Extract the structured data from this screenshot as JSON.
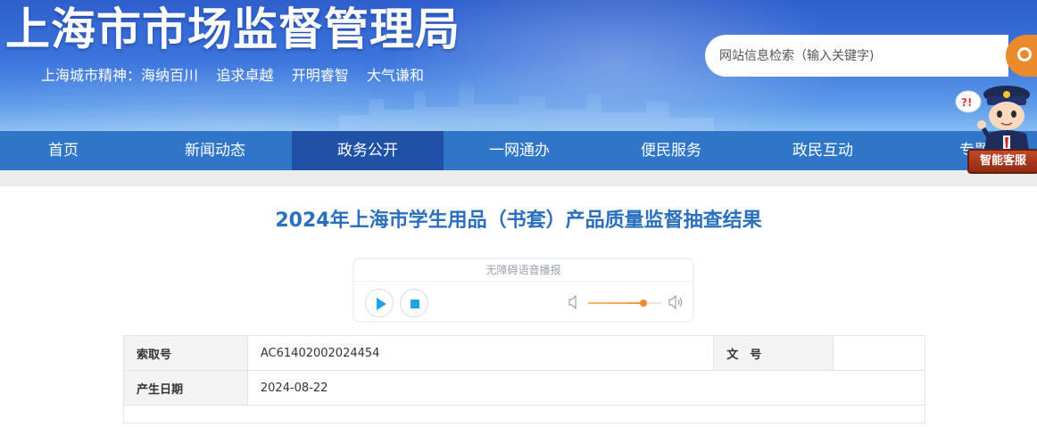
{
  "header": {
    "title": "上海市市场监督管理局",
    "motto": "上海城市精神：海纳百川    追求卓越    开明睿智    大气谦和"
  },
  "search": {
    "placeholder": "网站信息检索（输入关键字)",
    "button_icon": "search-icon"
  },
  "nav": {
    "items": [
      {
        "label": "首页"
      },
      {
        "label": "新闻动态"
      },
      {
        "label": "政务公开"
      },
      {
        "label": "一网通办"
      },
      {
        "label": "便民服务"
      },
      {
        "label": "政民互动"
      },
      {
        "label": "专题"
      }
    ],
    "active_index": 2
  },
  "assistant": {
    "label": "智能客服",
    "bubble": "?!"
  },
  "article": {
    "title": "2024年上海市学生用品（书套）产品质量监督抽查结果"
  },
  "player": {
    "label": "无障碍语音播报",
    "volume_level": 0.76,
    "icons": [
      "play-icon",
      "stop-icon",
      "volume-low-icon",
      "volume-high-icon"
    ]
  },
  "info": {
    "index_label": "索取号",
    "index_value": "AC61402002024454",
    "doc_no_label": "文　号",
    "doc_no_value": "",
    "date_label": "产生日期",
    "date_value": "2024-08-22"
  },
  "colors": {
    "nav_bg": "#2f76c8",
    "nav_active": "#1f52a6",
    "title_blue": "#2b6fbf",
    "search_button": "#e98a2c",
    "player_accent": "#1fa3e8"
  }
}
